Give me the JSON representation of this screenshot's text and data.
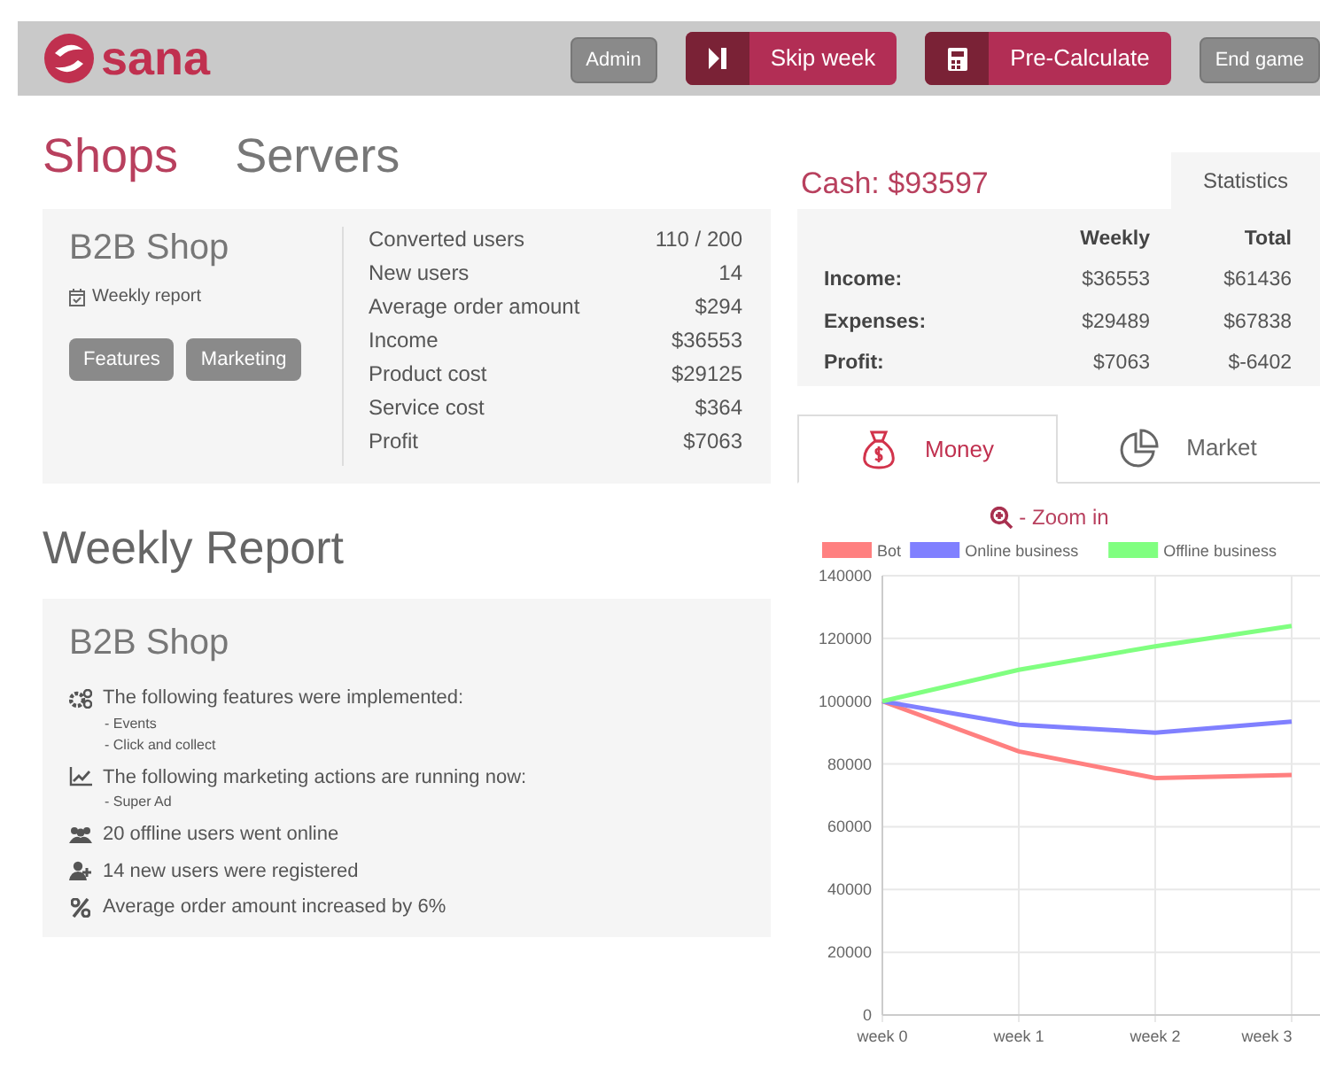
{
  "header": {
    "logo": "sana",
    "buttons": [
      {
        "label": "Admin",
        "kind": "plain"
      },
      {
        "label": "Skip week",
        "kind": "skip"
      },
      {
        "label": "Pre-Calculate",
        "kind": "calc"
      },
      {
        "label": "End game",
        "kind": "plain"
      }
    ]
  },
  "tabs": [
    {
      "label": "Shops",
      "selected": true
    },
    {
      "label": "Servers",
      "selected": false
    }
  ],
  "shop": {
    "name": "B2B Shop",
    "report_link": "Weekly report",
    "buttons": [
      "Features",
      "Marketing"
    ],
    "stats": [
      {
        "label": "Converted users",
        "value": "110 / 200"
      },
      {
        "label": "New users",
        "value": "14"
      },
      {
        "label": "Average order amount",
        "value": "$294"
      },
      {
        "label": "Income",
        "value": "$36553"
      },
      {
        "label": "Product cost",
        "value": "$29125"
      },
      {
        "label": "Service cost",
        "value": "$364"
      },
      {
        "label": "Profit",
        "value": "$7063"
      }
    ]
  },
  "weekly_report": {
    "title": "Weekly Report",
    "shop_name": "B2B Shop",
    "items": [
      {
        "kind": "features",
        "text": "The following features were implemented:",
        "details": [
          "- Events",
          "- Click and collect"
        ]
      },
      {
        "kind": "marketing",
        "text": "The following marketing actions are running now:",
        "details": [
          "- Super Ad"
        ]
      },
      {
        "kind": "online",
        "text": "20 offline users went online"
      },
      {
        "kind": "new_users",
        "text": "14 new users were registered"
      },
      {
        "kind": "percent",
        "text": "Average order amount increased by 6%"
      }
    ]
  },
  "cash": "Cash: $93597",
  "statistics": {
    "tab": "Statistics",
    "columns": [
      "Weekly",
      "Total"
    ],
    "rows": [
      {
        "label": "Income:",
        "weekly": "$36553",
        "total": "$61436"
      },
      {
        "label": "Expenses:",
        "weekly": "$29489",
        "total": "$67838"
      },
      {
        "label": "Profit:",
        "weekly": "$7063",
        "total": "$-6402"
      }
    ]
  },
  "chart_tabs": [
    {
      "label": "Money",
      "kind": "money",
      "selected": true
    },
    {
      "label": "Market",
      "kind": "market",
      "selected": false
    }
  ],
  "zoom_link": "- Zoom in",
  "chart_data": {
    "type": "line",
    "grid": true,
    "legend": true,
    "categories": [
      "week 0",
      "week 1",
      "week 2",
      "week 3"
    ],
    "ylim": [
      0,
      140000
    ],
    "yticks": [
      0,
      20000,
      40000,
      60000,
      80000,
      100000,
      120000,
      140000
    ],
    "series": [
      {
        "name": "Bot",
        "color": "#ff8080",
        "values": [
          100000,
          84000,
          75500,
          76500
        ]
      },
      {
        "name": "Online business",
        "color": "#8080ff",
        "values": [
          100000,
          92500,
          90000,
          93500
        ]
      },
      {
        "name": "Offline business",
        "color": "#80ff80",
        "values": [
          100000,
          110000,
          117500,
          124000
        ]
      }
    ]
  }
}
